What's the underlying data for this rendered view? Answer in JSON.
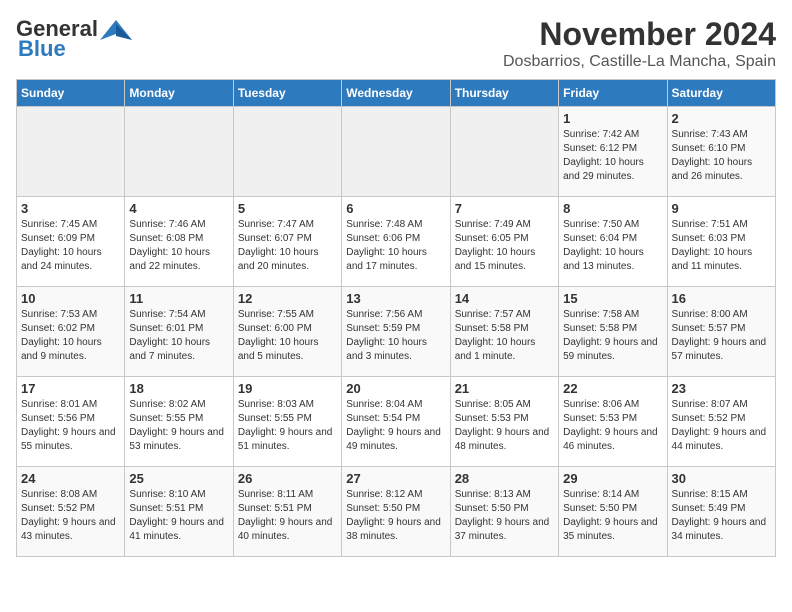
{
  "header": {
    "logo_general": "General",
    "logo_blue": "Blue",
    "month_year": "November 2024",
    "location": "Dosbarrios, Castille-La Mancha, Spain"
  },
  "calendar": {
    "days_of_week": [
      "Sunday",
      "Monday",
      "Tuesday",
      "Wednesday",
      "Thursday",
      "Friday",
      "Saturday"
    ],
    "weeks": [
      [
        {
          "day": "",
          "info": ""
        },
        {
          "day": "",
          "info": ""
        },
        {
          "day": "",
          "info": ""
        },
        {
          "day": "",
          "info": ""
        },
        {
          "day": "",
          "info": ""
        },
        {
          "day": "1",
          "info": "Sunrise: 7:42 AM\nSunset: 6:12 PM\nDaylight: 10 hours and 29 minutes."
        },
        {
          "day": "2",
          "info": "Sunrise: 7:43 AM\nSunset: 6:10 PM\nDaylight: 10 hours and 26 minutes."
        }
      ],
      [
        {
          "day": "3",
          "info": "Sunrise: 7:45 AM\nSunset: 6:09 PM\nDaylight: 10 hours and 24 minutes."
        },
        {
          "day": "4",
          "info": "Sunrise: 7:46 AM\nSunset: 6:08 PM\nDaylight: 10 hours and 22 minutes."
        },
        {
          "day": "5",
          "info": "Sunrise: 7:47 AM\nSunset: 6:07 PM\nDaylight: 10 hours and 20 minutes."
        },
        {
          "day": "6",
          "info": "Sunrise: 7:48 AM\nSunset: 6:06 PM\nDaylight: 10 hours and 17 minutes."
        },
        {
          "day": "7",
          "info": "Sunrise: 7:49 AM\nSunset: 6:05 PM\nDaylight: 10 hours and 15 minutes."
        },
        {
          "day": "8",
          "info": "Sunrise: 7:50 AM\nSunset: 6:04 PM\nDaylight: 10 hours and 13 minutes."
        },
        {
          "day": "9",
          "info": "Sunrise: 7:51 AM\nSunset: 6:03 PM\nDaylight: 10 hours and 11 minutes."
        }
      ],
      [
        {
          "day": "10",
          "info": "Sunrise: 7:53 AM\nSunset: 6:02 PM\nDaylight: 10 hours and 9 minutes."
        },
        {
          "day": "11",
          "info": "Sunrise: 7:54 AM\nSunset: 6:01 PM\nDaylight: 10 hours and 7 minutes."
        },
        {
          "day": "12",
          "info": "Sunrise: 7:55 AM\nSunset: 6:00 PM\nDaylight: 10 hours and 5 minutes."
        },
        {
          "day": "13",
          "info": "Sunrise: 7:56 AM\nSunset: 5:59 PM\nDaylight: 10 hours and 3 minutes."
        },
        {
          "day": "14",
          "info": "Sunrise: 7:57 AM\nSunset: 5:58 PM\nDaylight: 10 hours and 1 minute."
        },
        {
          "day": "15",
          "info": "Sunrise: 7:58 AM\nSunset: 5:58 PM\nDaylight: 9 hours and 59 minutes."
        },
        {
          "day": "16",
          "info": "Sunrise: 8:00 AM\nSunset: 5:57 PM\nDaylight: 9 hours and 57 minutes."
        }
      ],
      [
        {
          "day": "17",
          "info": "Sunrise: 8:01 AM\nSunset: 5:56 PM\nDaylight: 9 hours and 55 minutes."
        },
        {
          "day": "18",
          "info": "Sunrise: 8:02 AM\nSunset: 5:55 PM\nDaylight: 9 hours and 53 minutes."
        },
        {
          "day": "19",
          "info": "Sunrise: 8:03 AM\nSunset: 5:55 PM\nDaylight: 9 hours and 51 minutes."
        },
        {
          "day": "20",
          "info": "Sunrise: 8:04 AM\nSunset: 5:54 PM\nDaylight: 9 hours and 49 minutes."
        },
        {
          "day": "21",
          "info": "Sunrise: 8:05 AM\nSunset: 5:53 PM\nDaylight: 9 hours and 48 minutes."
        },
        {
          "day": "22",
          "info": "Sunrise: 8:06 AM\nSunset: 5:53 PM\nDaylight: 9 hours and 46 minutes."
        },
        {
          "day": "23",
          "info": "Sunrise: 8:07 AM\nSunset: 5:52 PM\nDaylight: 9 hours and 44 minutes."
        }
      ],
      [
        {
          "day": "24",
          "info": "Sunrise: 8:08 AM\nSunset: 5:52 PM\nDaylight: 9 hours and 43 minutes."
        },
        {
          "day": "25",
          "info": "Sunrise: 8:10 AM\nSunset: 5:51 PM\nDaylight: 9 hours and 41 minutes."
        },
        {
          "day": "26",
          "info": "Sunrise: 8:11 AM\nSunset: 5:51 PM\nDaylight: 9 hours and 40 minutes."
        },
        {
          "day": "27",
          "info": "Sunrise: 8:12 AM\nSunset: 5:50 PM\nDaylight: 9 hours and 38 minutes."
        },
        {
          "day": "28",
          "info": "Sunrise: 8:13 AM\nSunset: 5:50 PM\nDaylight: 9 hours and 37 minutes."
        },
        {
          "day": "29",
          "info": "Sunrise: 8:14 AM\nSunset: 5:50 PM\nDaylight: 9 hours and 35 minutes."
        },
        {
          "day": "30",
          "info": "Sunrise: 8:15 AM\nSunset: 5:49 PM\nDaylight: 9 hours and 34 minutes."
        }
      ]
    ]
  }
}
